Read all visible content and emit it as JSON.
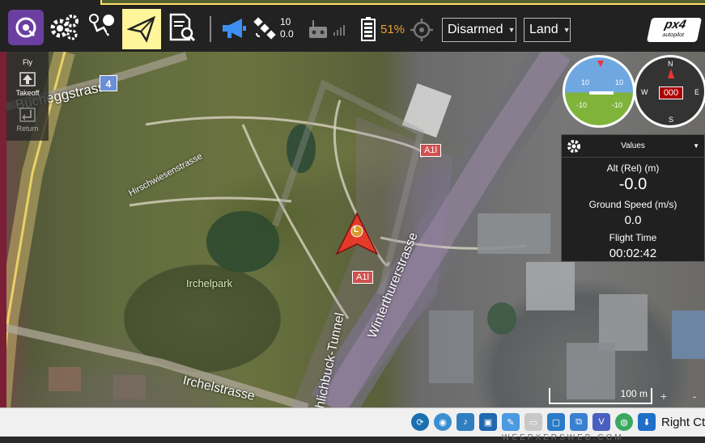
{
  "toolbar": {
    "gps_satellites": "10",
    "gps_hdop": "0.0",
    "battery_percent": "51%",
    "arm_state": "Disarmed",
    "flight_mode": "Land",
    "brand_logo": "px4",
    "brand_sub": "autopilot",
    "icons": [
      "qgc-logo-icon",
      "settings-gears-icon",
      "plan-route-icon",
      "fly-paper-plane-icon",
      "analyze-document-icon",
      "megaphone-icon",
      "gps-satellite-icon",
      "rc-transmitter-icon",
      "signal-bars-icon",
      "battery-icon",
      "crosshair-icon"
    ],
    "colors": {
      "active_tab": "#fff59a",
      "qgc_purple": "#6b3fa0",
      "battery": "#f0a030"
    }
  },
  "fly_tools": {
    "header": "Fly",
    "takeoff": "Takeoff",
    "return": "Return"
  },
  "map": {
    "labels": {
      "street_top": "Buchegg strasse",
      "street_top_visible": "ggstrasse",
      "street_prefix": "Buche",
      "route_4": "4",
      "hirschwiesen": "Hirschwiesenstrasse",
      "irchelpark": "Irchelpark",
      "a1l_top": "A1l",
      "a1l_bottom": "A1l",
      "winterthurer": "Winterthurerstrasse",
      "tunnel": "hlichbuck-Tunnel",
      "irchelstrasse": "Irchelstrasse"
    },
    "vehicle_marker_letter": "L",
    "scale_label": "100 m",
    "zoom_in": "+",
    "zoom_out": "-"
  },
  "instruments": {
    "attitude_ticks": [
      "10",
      "10",
      "-10",
      "-10"
    ],
    "compass_heading": "000",
    "compass_labels": [
      "N",
      "E",
      "S",
      "W"
    ],
    "values_header": "Values",
    "values": [
      {
        "label": "Alt (Rel) (m)",
        "value": "-0.0"
      },
      {
        "label": "Ground Speed (m/s)",
        "value": "0.0"
      },
      {
        "label": "Flight Time",
        "value": "00:02:42"
      }
    ]
  },
  "taskbar": {
    "right_label": "Right Ct",
    "tray_icons": [
      "usb-icon",
      "cd-icon",
      "audio-icon",
      "network-icon",
      "pen-icon",
      "folder-icon",
      "display-icon",
      "shared-icon",
      "virtualbox-icon",
      "globe-icon",
      "download-icon"
    ]
  },
  "watermark": "WEEPXERSWEB.COM"
}
